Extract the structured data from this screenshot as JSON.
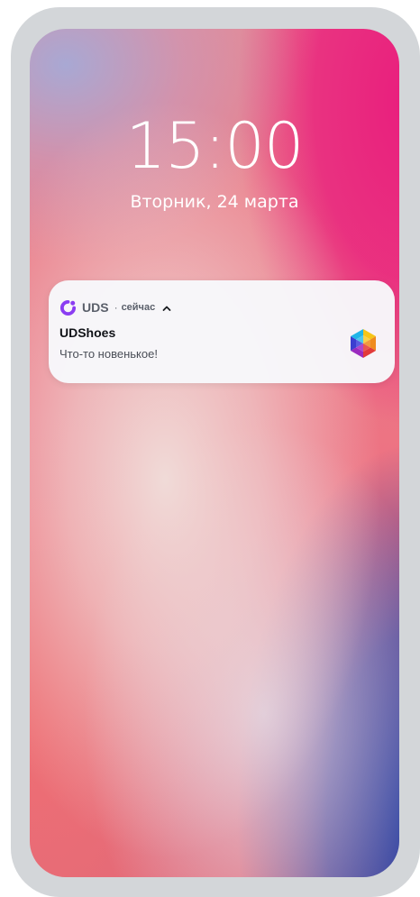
{
  "lock_screen": {
    "time": "15:00",
    "date": "Вторник, 24 марта"
  },
  "notification": {
    "app_name": "UDS",
    "separator": "·",
    "time": "сейчас",
    "title": "UDShoes",
    "body": "Что-то новенькое!",
    "app_icon": "uds-logo-icon",
    "expand_icon": "chevron-up-icon",
    "brand_icon": "udshoes-logo-icon"
  },
  "colors": {
    "app_accent": "#8b3df2",
    "wallpaper_pink": "#e91e7d",
    "wallpaper_coral": "#ee6f80",
    "wallpaper_blue": "#233ca0",
    "frame": "#d3d6d9"
  }
}
